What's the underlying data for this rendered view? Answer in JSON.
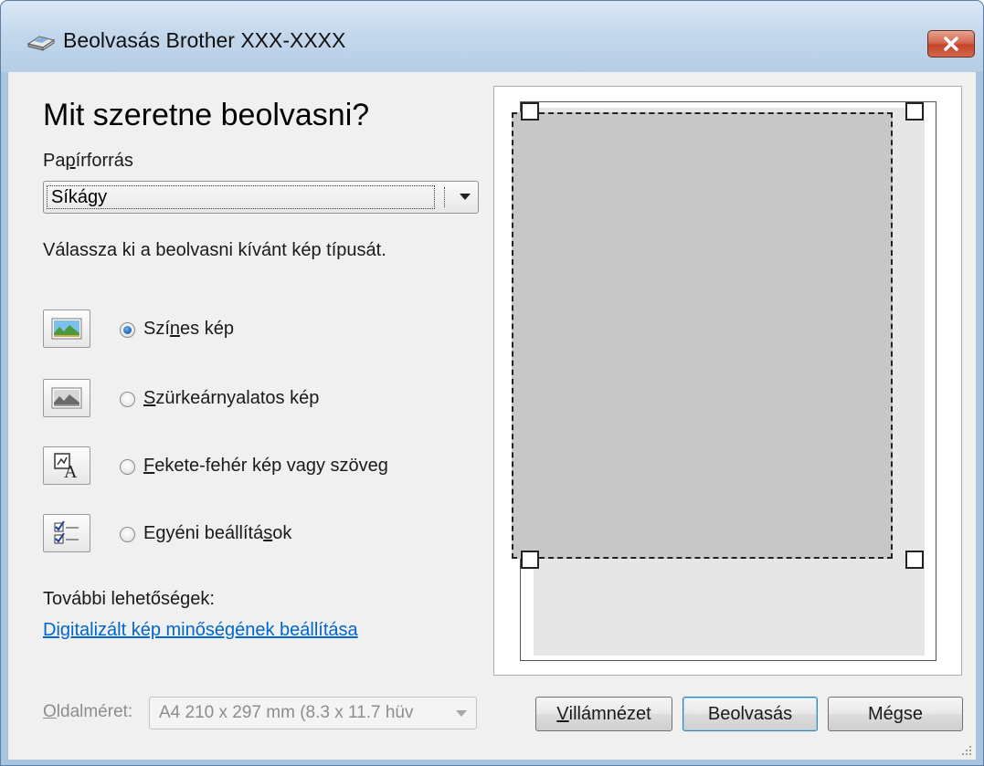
{
  "window": {
    "title": "Beolvasás Brother XXX-XXXX",
    "accent_color": "#c2462b"
  },
  "main": {
    "heading": "Mit szeretne beolvasni?",
    "paper_source": {
      "label_pre": "Pa",
      "label_ul": "p",
      "label_post": "írforrás",
      "value": "Síkágy"
    },
    "instruction": "Válassza ki a beolvasni kívánt kép típusát.",
    "options": [
      {
        "icon": "color-photo-icon",
        "pre": "Szí",
        "ul": "n",
        "post": "es kép",
        "checked": true
      },
      {
        "icon": "grayscale-photo-icon",
        "pre": "",
        "ul": "S",
        "post": "zürkeárnyalatos kép",
        "checked": false
      },
      {
        "icon": "text-document-icon",
        "pre": "",
        "ul": "F",
        "post": "ekete-fehér kép vagy szöveg",
        "checked": false
      },
      {
        "icon": "custom-settings-icon",
        "pre": "Egyéni beállítá",
        "ul": "s",
        "post": "ok",
        "checked": false
      }
    ],
    "more_options_label": "További lehetőségek:",
    "quality_link": "Digitalizált kép minőségének beállítása"
  },
  "footer": {
    "page_size_label_ul": "O",
    "page_size_label_rest": "ldalméret:",
    "page_size_value": "A4 210 x 297 mm (8.3 x 11.7 hüv",
    "preview_ul": "V",
    "preview_rest": "illámnézet",
    "scan_button": "Beolvasás",
    "cancel_button": "Mégse"
  }
}
